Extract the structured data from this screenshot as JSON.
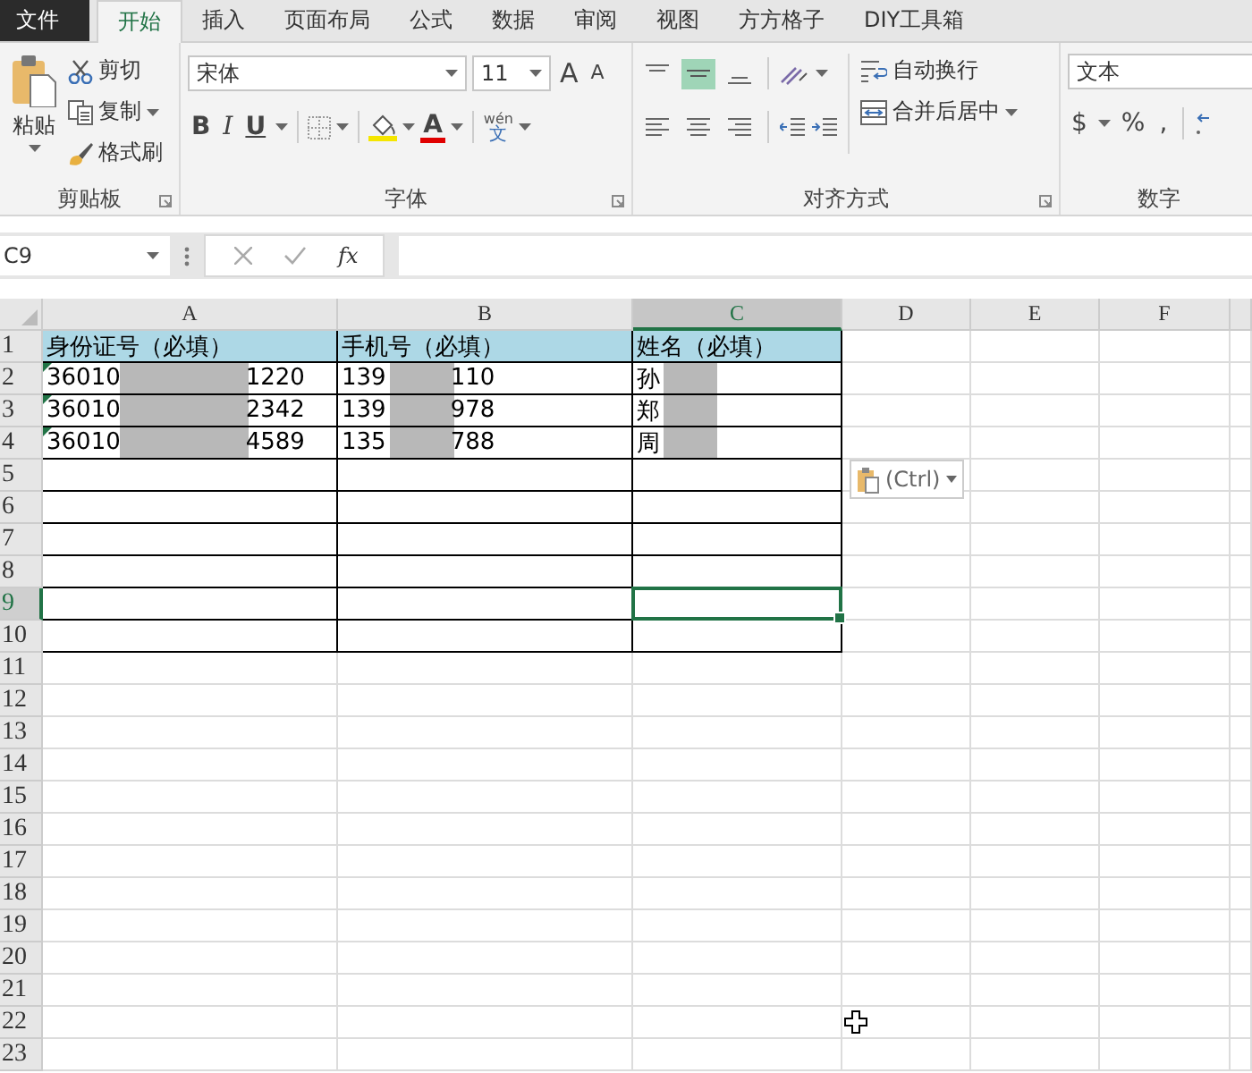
{
  "tabs": [
    {
      "label": "文件",
      "kind": "file",
      "selected": false
    },
    {
      "label": "开始",
      "kind": "tab",
      "selected": true
    },
    {
      "label": "插入",
      "kind": "tab",
      "selected": false
    },
    {
      "label": "页面布局",
      "kind": "tab",
      "selected": false
    },
    {
      "label": "公式",
      "kind": "tab",
      "selected": false
    },
    {
      "label": "数据",
      "kind": "tab",
      "selected": false
    },
    {
      "label": "审阅",
      "kind": "tab",
      "selected": false
    },
    {
      "label": "视图",
      "kind": "tab",
      "selected": false
    },
    {
      "label": "方方格子",
      "kind": "tab",
      "selected": false
    },
    {
      "label": "DIY工具箱",
      "kind": "tab",
      "selected": false
    }
  ],
  "clipboard": {
    "paste": "粘贴",
    "cut": "剪切",
    "copy": "复制",
    "format_painter": "格式刷",
    "label": "剪贴板"
  },
  "font": {
    "name": "宋体",
    "size": "11",
    "grow": "A",
    "shrink": "A",
    "bold": "B",
    "italic": "I",
    "underline": "U",
    "color_letter": "A",
    "phonetic_top": "wén",
    "phonetic_bottom": "文",
    "label": "字体"
  },
  "alignment": {
    "middle_selected": true,
    "wrap": "自动换行",
    "merge": "合并后居中",
    "label": "对齐方式"
  },
  "number": {
    "format": "文本",
    "currency": "$",
    "percent": "%",
    "comma": ",",
    "label": "数字"
  },
  "formula_bar": {
    "name_box": "C9",
    "fx": "fx"
  },
  "sheet": {
    "columns": [
      {
        "label": "A",
        "selected": false
      },
      {
        "label": "B",
        "selected": false
      },
      {
        "label": "C",
        "selected": true
      },
      {
        "label": "D",
        "selected": false
      },
      {
        "label": "E",
        "selected": false
      },
      {
        "label": "F",
        "selected": false
      }
    ],
    "rows": [
      {
        "header": "1",
        "selected": false,
        "bordered": true,
        "heading": true,
        "cells": [
          {
            "text": "身份证号（必填）"
          },
          {
            "text": "手机号（必填）"
          },
          {
            "text": "姓名（必填）"
          }
        ]
      },
      {
        "header": "2",
        "selected": false,
        "bordered": true,
        "heading": false,
        "cells": [
          {
            "text": "36010",
            "tail": "1220",
            "redacted": true,
            "flag": true
          },
          {
            "text": "139",
            "tail": "110",
            "redacted": true
          },
          {
            "text": "孙",
            "redacted": true
          }
        ]
      },
      {
        "header": "3",
        "selected": false,
        "bordered": true,
        "heading": false,
        "cells": [
          {
            "text": "36010",
            "tail": "2342",
            "redacted": true,
            "flag": true
          },
          {
            "text": "139",
            "tail": "978",
            "redacted": true
          },
          {
            "text": "郑",
            "redacted": true
          }
        ]
      },
      {
        "header": "4",
        "selected": false,
        "bordered": true,
        "heading": false,
        "cells": [
          {
            "text": "36010",
            "tail": "4589",
            "redacted": true,
            "flag": true
          },
          {
            "text": "135",
            "tail": "788",
            "redacted": true
          },
          {
            "text": "周",
            "redacted": true
          }
        ]
      },
      {
        "header": "5",
        "selected": false,
        "bordered": true,
        "heading": false
      },
      {
        "header": "6",
        "selected": false,
        "bordered": true,
        "heading": false
      },
      {
        "header": "7",
        "selected": false,
        "bordered": true,
        "heading": false
      },
      {
        "header": "8",
        "selected": false,
        "bordered": true,
        "heading": false
      },
      {
        "header": "9",
        "selected": true,
        "bordered": true,
        "heading": false,
        "cells": [
          {
            "active": false
          },
          {
            "active": false
          },
          {
            "active": true
          }
        ]
      },
      {
        "header": "10",
        "selected": false,
        "bordered": true,
        "heading": false
      },
      {
        "header": "11",
        "selected": false,
        "bordered": false,
        "heading": false
      },
      {
        "header": "12",
        "selected": false,
        "bordered": false,
        "heading": false
      },
      {
        "header": "13",
        "selected": false,
        "bordered": false,
        "heading": false
      },
      {
        "header": "14",
        "selected": false,
        "bordered": false,
        "heading": false
      },
      {
        "header": "15",
        "selected": false,
        "bordered": false,
        "heading": false
      },
      {
        "header": "16",
        "selected": false,
        "bordered": false,
        "heading": false
      },
      {
        "header": "17",
        "selected": false,
        "bordered": false,
        "heading": false
      },
      {
        "header": "18",
        "selected": false,
        "bordered": false,
        "heading": false
      },
      {
        "header": "19",
        "selected": false,
        "bordered": false,
        "heading": false
      },
      {
        "header": "20",
        "selected": false,
        "bordered": false,
        "heading": false
      },
      {
        "header": "21",
        "selected": false,
        "bordered": false,
        "heading": false
      },
      {
        "header": "22",
        "selected": false,
        "bordered": false,
        "heading": false
      },
      {
        "header": "23",
        "selected": false,
        "bordered": false,
        "heading": false
      }
    ]
  },
  "paste_options": {
    "label": "(Ctrl)"
  }
}
